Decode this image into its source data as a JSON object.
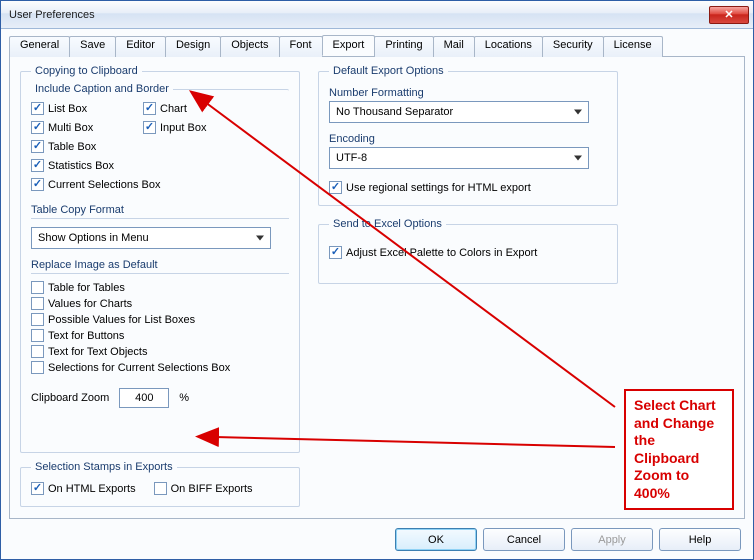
{
  "window": {
    "title": "User Preferences"
  },
  "tabs": {
    "general": "General",
    "save": "Save",
    "editor": "Editor",
    "design": "Design",
    "objects": "Objects",
    "font": "Font",
    "export": "Export",
    "printing": "Printing",
    "mail": "Mail",
    "locations": "Locations",
    "security": "Security",
    "license": "License"
  },
  "copying": {
    "legend": "Copying to Clipboard",
    "include_legend": "Include Caption and Border",
    "list_box": "List Box",
    "chart": "Chart",
    "multi_box": "Multi Box",
    "input_box": "Input Box",
    "table_box": "Table Box",
    "statistics_box": "Statistics Box",
    "current_selections_box": "Current Selections Box",
    "table_copy_format_label": "Table Copy Format",
    "table_copy_format_value": "Show Options in Menu",
    "replace_legend": "Replace Image as Default",
    "table_for_tables": "Table for Tables",
    "values_for_charts": "Values for Charts",
    "possible_values_list": "Possible Values for List Boxes",
    "text_for_buttons": "Text for Buttons",
    "text_for_text_objects": "Text for Text Objects",
    "selections_for_csbox": "Selections for Current Selections Box",
    "clipboard_zoom_label": "Clipboard Zoom",
    "clipboard_zoom_value": "400",
    "percent": "%"
  },
  "selection_stamps": {
    "legend": "Selection Stamps in Exports",
    "on_html": "On HTML Exports",
    "on_biff": "On BIFF Exports"
  },
  "default_export": {
    "legend": "Default Export Options",
    "number_formatting_label": "Number Formatting",
    "number_formatting_value": "No Thousand Separator",
    "encoding_label": "Encoding",
    "encoding_value": "UTF-8",
    "use_regional": "Use regional settings for HTML export"
  },
  "excel": {
    "legend": "Send to Excel Options",
    "adjust_palette": "Adjust Excel Palette to Colors in Export"
  },
  "buttons": {
    "ok": "OK",
    "cancel": "Cancel",
    "apply": "Apply",
    "help": "Help"
  },
  "annotation": {
    "line1": "Select Chart",
    "line2": "and Change",
    "line3": "the",
    "line4": "Clipboard",
    "line5": "Zoom to",
    "line6": "400%"
  }
}
